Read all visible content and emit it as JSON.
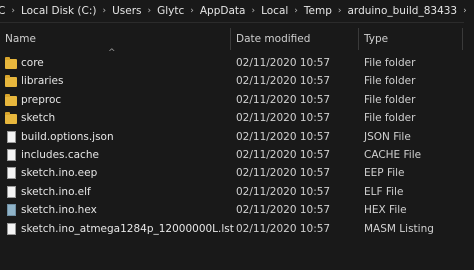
{
  "breadcrumb": [
    "C",
    "Local Disk (C:)",
    "Users",
    "Glytc",
    "AppData",
    "Local",
    "Temp",
    "arduino_build_83433"
  ],
  "breadcrumb_separator": "›",
  "columns": {
    "name": "Name",
    "date_modified": "Date modified",
    "type": "Type"
  },
  "sort_indicator": "^",
  "files": [
    {
      "name": "core",
      "date": "02/11/2020 10:57",
      "type": "File folder",
      "icon": "folder-icon"
    },
    {
      "name": "libraries",
      "date": "02/11/2020 10:57",
      "type": "File folder",
      "icon": "folder-icon"
    },
    {
      "name": "preproc",
      "date": "02/11/2020 10:57",
      "type": "File folder",
      "icon": "folder-icon"
    },
    {
      "name": "sketch",
      "date": "02/11/2020 10:57",
      "type": "File folder",
      "icon": "folder-icon"
    },
    {
      "name": "build.options.json",
      "date": "02/11/2020 10:57",
      "type": "JSON File",
      "icon": "file-icon"
    },
    {
      "name": "includes.cache",
      "date": "02/11/2020 10:57",
      "type": "CACHE File",
      "icon": "file-icon"
    },
    {
      "name": "sketch.ino.eep",
      "date": "02/11/2020 10:57",
      "type": "EEP File",
      "icon": "file-icon"
    },
    {
      "name": "sketch.ino.elf",
      "date": "02/11/2020 10:57",
      "type": "ELF File",
      "icon": "file-icon"
    },
    {
      "name": "sketch.ino.hex",
      "date": "02/11/2020 10:57",
      "type": "HEX File",
      "icon": "hex-file-icon"
    },
    {
      "name": "sketch.ino_atmega1284p_12000000L.lst",
      "date": "02/11/2020 10:57",
      "type": "MASM Listing",
      "icon": "file-icon"
    }
  ],
  "colors": {
    "background": "#191919",
    "folder": "#e8b73d",
    "text": "#e6e6e6"
  }
}
